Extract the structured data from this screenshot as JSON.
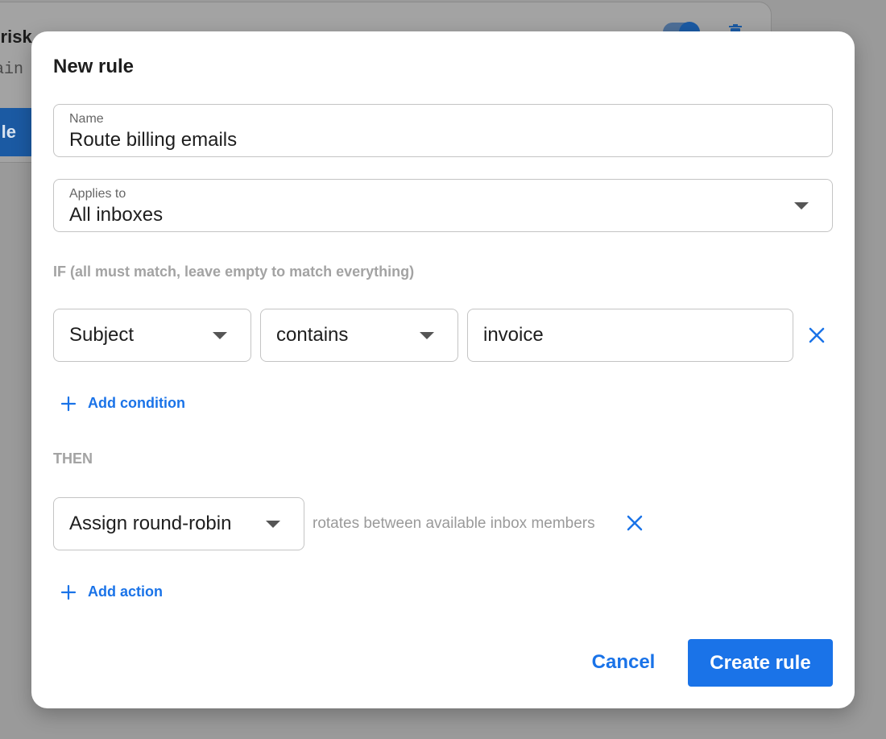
{
  "background": {
    "rule_title_fragment": "n risk",
    "rule_sub_fragment": "tain",
    "button_fragment": "le"
  },
  "modal": {
    "title": "New rule",
    "name_field": {
      "label": "Name",
      "value": "Route billing emails"
    },
    "applies_to_field": {
      "label": "Applies to",
      "value": "All inboxes"
    },
    "if_section": {
      "label": "IF (all must match, leave empty to match everything)",
      "conditions": [
        {
          "field": "Subject",
          "operator": "contains",
          "value": "invoice"
        }
      ],
      "add_label": "Add condition"
    },
    "then_section": {
      "label": "THEN",
      "actions": [
        {
          "action": "Assign round-robin",
          "hint": "rotates between available inbox members"
        }
      ],
      "add_label": "Add action"
    },
    "cancel_label": "Cancel",
    "create_label": "Create rule"
  },
  "colors": {
    "accent": "#1a73e8",
    "overlay": "#9a9a9a"
  },
  "icons": {
    "remove": "close-icon",
    "add": "plus-icon",
    "dropdown": "caret-down-icon",
    "delete": "trash-icon"
  }
}
